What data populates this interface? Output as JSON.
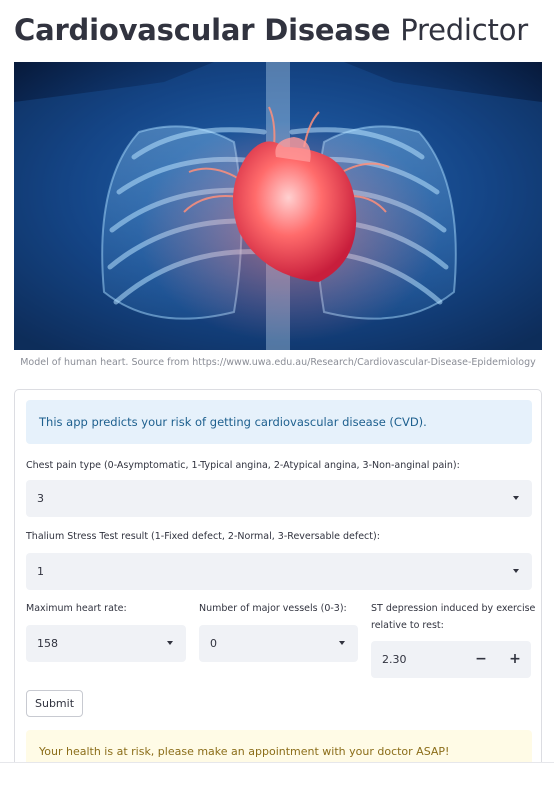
{
  "header": {
    "title_bold": "Cardiovascular Disease",
    "title_regular": "Predictor"
  },
  "hero": {
    "caption": "Model of human heart. Source from https://www.uwa.edu.au/Research/Cardiovascular-Disease-Epidemiology"
  },
  "form": {
    "info_text": "This app predicts your risk of getting cardiovascular disease (CVD).",
    "chest_pain": {
      "label": "Chest pain type (0-Asymptomatic, 1-Typical angina, 2-Atypical angina, 3-Non-anginal pain):",
      "value": "3"
    },
    "thalium": {
      "label": "Thalium Stress Test result (1-Fixed defect, 2-Normal, 3-Reversable defect):",
      "value": "1"
    },
    "max_heart_rate": {
      "label": "Maximum heart rate:",
      "value": "158"
    },
    "major_vessels": {
      "label": "Number of major vessels (0-3):",
      "value": "0"
    },
    "st_depression": {
      "label_line1": "ST depression induced by exercise",
      "label_line2": "relative to rest:",
      "value": "2.30",
      "minus": "−",
      "plus": "+"
    },
    "submit_label": "Submit",
    "result_text": "Your health is at risk, please make an appointment with your doctor ASAP!"
  }
}
